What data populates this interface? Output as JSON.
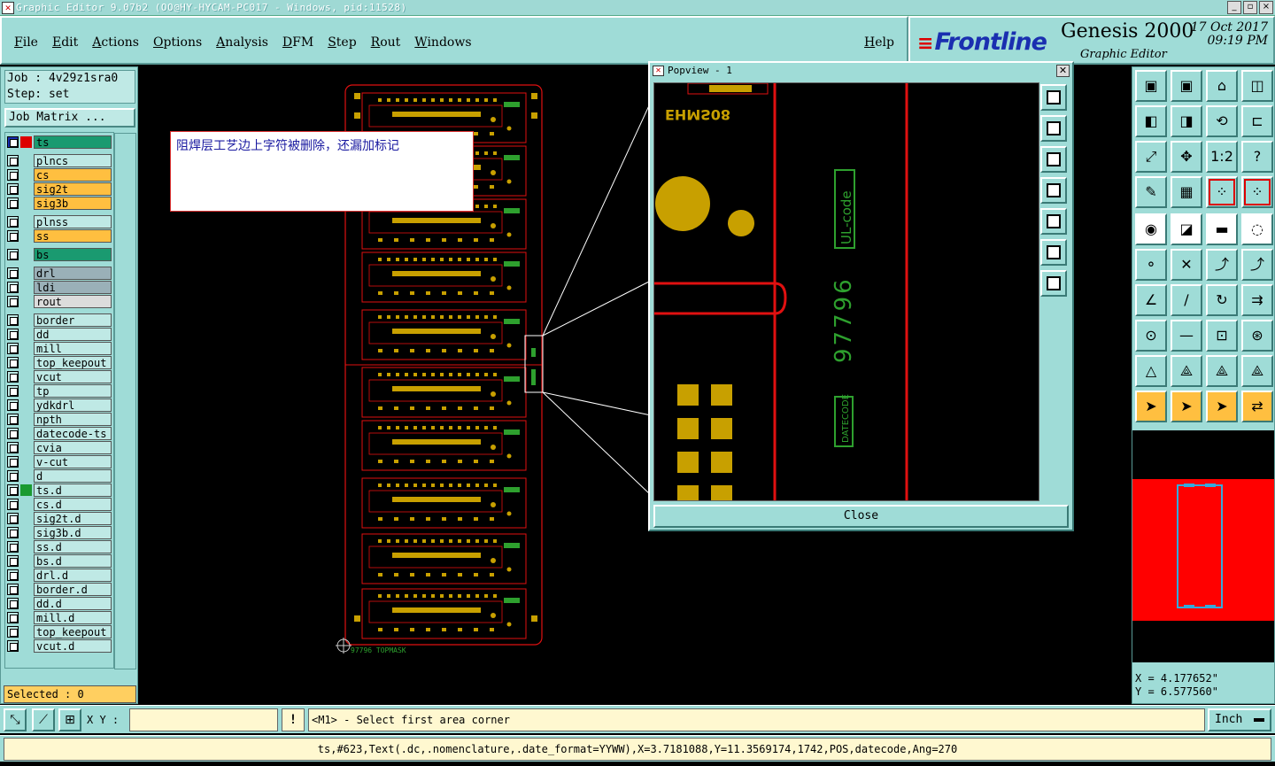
{
  "window": {
    "title": "Graphic Editor 9.07b2 (OO@HY-HYCAM-PC017 - Windows, pid:11528)",
    "buttons": [
      "_",
      "▫",
      "×"
    ]
  },
  "menubar": {
    "items": [
      "File",
      "Edit",
      "Actions",
      "Options",
      "Analysis",
      "DFM",
      "Step",
      "Rout",
      "Windows"
    ],
    "help": "Help"
  },
  "brand": {
    "logo": "Frontline",
    "product": "Genesis 2000",
    "subtitle": "Graphic Editor",
    "date": "17 Oct 2017",
    "time": "09:19 PM"
  },
  "job": {
    "job_line": "Job : 4v29z1sra0",
    "step_line": "Step: set",
    "matrix_button": "Job Matrix ..."
  },
  "layers": [
    {
      "name": "ts",
      "color": "#1a9a70",
      "active": true,
      "marker": "#d00"
    },
    {
      "name": "plncs",
      "color": "#bfe9e5"
    },
    {
      "name": "cs",
      "color": "#ffbf40"
    },
    {
      "name": "sig2t",
      "color": "#ffbf40"
    },
    {
      "name": "sig3b",
      "color": "#ffbf40"
    },
    {
      "name": "plnss",
      "color": "#bfe9e5"
    },
    {
      "name": "ss",
      "color": "#ffbf40"
    },
    {
      "name": "bs",
      "color": "#1a9a70"
    },
    {
      "name": "drl",
      "color": "#9ab0b8"
    },
    {
      "name": "ldi",
      "color": "#9ab0b8"
    },
    {
      "name": "rout",
      "color": "#dcdcdc"
    },
    {
      "name": "border",
      "color": "#bfe9e5"
    },
    {
      "name": "dd",
      "color": "#bfe9e5"
    },
    {
      "name": "mill",
      "color": "#bfe9e5"
    },
    {
      "name": "top_keepout",
      "color": "#bfe9e5"
    },
    {
      "name": "vcut",
      "color": "#bfe9e5"
    },
    {
      "name": "tp",
      "color": "#bfe9e5"
    },
    {
      "name": "ydkdrl",
      "color": "#bfe9e5"
    },
    {
      "name": "npth",
      "color": "#bfe9e5"
    },
    {
      "name": "datecode-ts",
      "color": "#bfe9e5"
    },
    {
      "name": "cvia",
      "color": "#bfe9e5"
    },
    {
      "name": "v-cut",
      "color": "#bfe9e5"
    },
    {
      "name": "d",
      "color": "#bfe9e5"
    },
    {
      "name": "ts.d",
      "color": "#bfe9e5",
      "marker": "#1a9a30"
    },
    {
      "name": "cs.d",
      "color": "#bfe9e5"
    },
    {
      "name": "sig2t.d",
      "color": "#bfe9e5"
    },
    {
      "name": "sig3b.d",
      "color": "#bfe9e5"
    },
    {
      "name": "ss.d",
      "color": "#bfe9e5"
    },
    {
      "name": "bs.d",
      "color": "#bfe9e5"
    },
    {
      "name": "drl.d",
      "color": "#bfe9e5"
    },
    {
      "name": "border.d",
      "color": "#bfe9e5"
    },
    {
      "name": "dd.d",
      "color": "#bfe9e5"
    },
    {
      "name": "mill.d",
      "color": "#bfe9e5"
    },
    {
      "name": "top_keepout",
      "color": "#bfe9e5"
    },
    {
      "name": "vcut.d",
      "color": "#bfe9e5"
    }
  ],
  "selected": "Selected : 0",
  "note": "阻焊层工艺边上字符被删除，还漏加标记",
  "canvas": {
    "board_label": "97796  TOPMASK"
  },
  "popview": {
    "title": "Popview - 1",
    "close_button": "Close",
    "texts": {
      "ul": "UL-code",
      "number": "97796",
      "datecode": "DATECODE",
      "mirror": "EHMS08"
    }
  },
  "coords": {
    "x": "X = 4.177652\"",
    "y": "Y = 6.577560\""
  },
  "bottom": {
    "xy_label": "X Y :",
    "xy_value": "",
    "warn": "!",
    "prompt": "<M1> - Select first area corner",
    "units": "Inch",
    "status": "ts,#623,Text(.dc,.nomenclature,.date_format=YYWW),X=3.7181088,Y=11.3569174,1742,POS,datecode,Ang=270"
  },
  "colors": {
    "panel": "#9fdcd7",
    "copper": "#c8a000",
    "outline": "#e01010",
    "silk": "#2ea02e"
  }
}
